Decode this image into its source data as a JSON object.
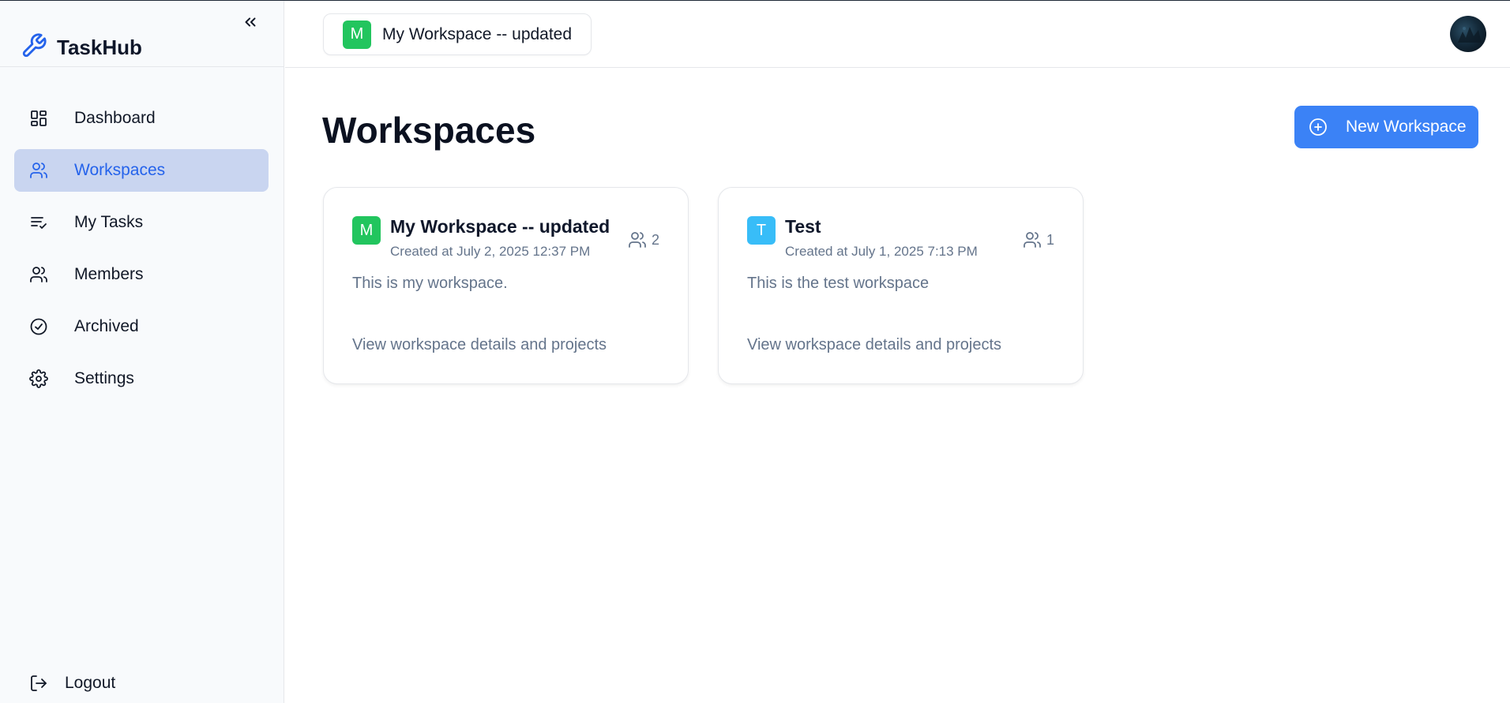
{
  "app": {
    "name": "TaskHub",
    "brand_icon": "wrench-icon",
    "brand_color": "#2563eb"
  },
  "sidebar": {
    "collapse_icon": "chevrons-left-icon",
    "items": [
      {
        "label": "Dashboard",
        "icon": "layout-dashboard-icon",
        "active": false
      },
      {
        "label": "Workspaces",
        "icon": "users-icon",
        "active": true
      },
      {
        "label": "My Tasks",
        "icon": "list-checks-icon",
        "active": false
      },
      {
        "label": "Members",
        "icon": "users-icon",
        "active": false
      },
      {
        "label": "Archived",
        "icon": "check-circle-icon",
        "active": false
      },
      {
        "label": "Settings",
        "icon": "gear-icon",
        "active": false
      }
    ],
    "logout_label": "Logout",
    "active_bg": "#c9d5f0",
    "active_color": "#2563eb"
  },
  "header": {
    "current_workspace": {
      "letter": "M",
      "name": "My Workspace -- updated",
      "color": "#22c55e"
    }
  },
  "main": {
    "title": "Workspaces",
    "new_button_label": "New Workspace",
    "new_button_icon": "plus-circle-icon",
    "accent": "#3b82f6",
    "workspaces": [
      {
        "letter": "M",
        "color": "#22c55e",
        "name": "My Workspace -- updated",
        "created": "Created at July 2, 2025 12:37 PM",
        "members": "2",
        "description": "This is my workspace.",
        "link": "View workspace details and projects"
      },
      {
        "letter": "T",
        "color": "#38bdf8",
        "name": "Test",
        "created": "Created at July 1, 2025 7:13 PM",
        "members": "1",
        "description": "This is the test workspace",
        "link": "View workspace details and projects"
      }
    ]
  }
}
